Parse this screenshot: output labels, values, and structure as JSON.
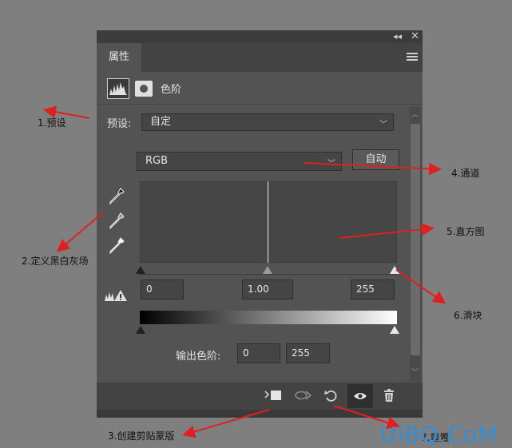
{
  "panel": {
    "tab_label": "属性",
    "adjustment_title": "色阶",
    "preset": {
      "label": "预设:",
      "value": "自定"
    },
    "channel": {
      "value": "RGB",
      "auto_label": "自动"
    },
    "input_levels": {
      "black": "0",
      "gamma": "1.00",
      "white": "255"
    },
    "output": {
      "label": "输出色阶:",
      "black": "0",
      "white": "255"
    }
  },
  "annotations": {
    "preset": "1.预设",
    "eyedroppers": "2.定义黑白灰场",
    "clip": "3.创建剪贴蒙版",
    "channel": "4.通道",
    "histogram": "5.直方图",
    "slider": "6.滑块",
    "reset": "7.重置"
  },
  "watermark": "UiBQ.CoM"
}
